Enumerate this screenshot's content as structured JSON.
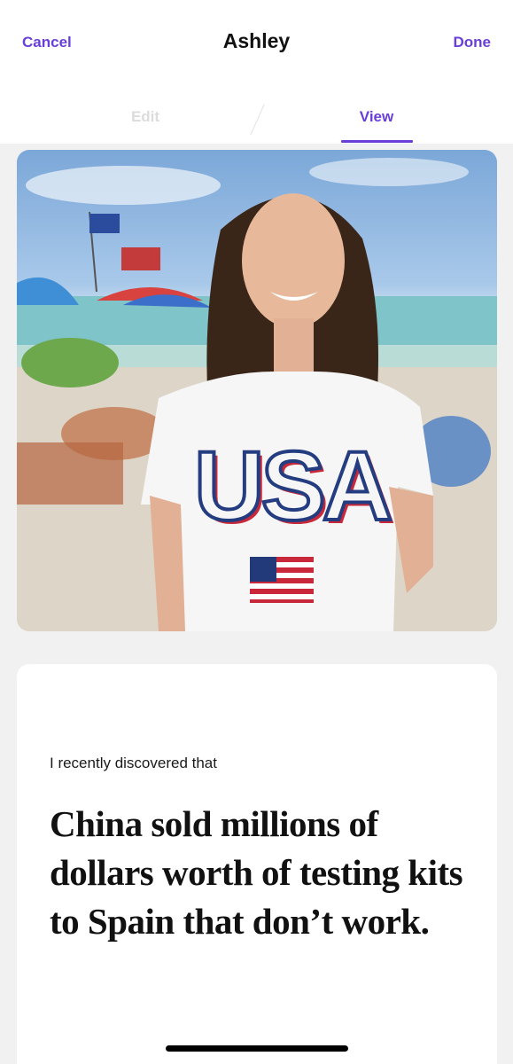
{
  "colors": {
    "accent": "#6a3fd9"
  },
  "header": {
    "cancel_label": "Cancel",
    "title": "Ashley",
    "done_label": "Done"
  },
  "tabs": [
    {
      "label": "Edit",
      "active": false
    },
    {
      "label": "View",
      "active": true
    }
  ],
  "photo": {
    "shirt_text": "USA"
  },
  "card": {
    "intro": "I recently discovered that",
    "statement": "China sold millions of dollars worth of testing kits to Spain that don’t work."
  }
}
